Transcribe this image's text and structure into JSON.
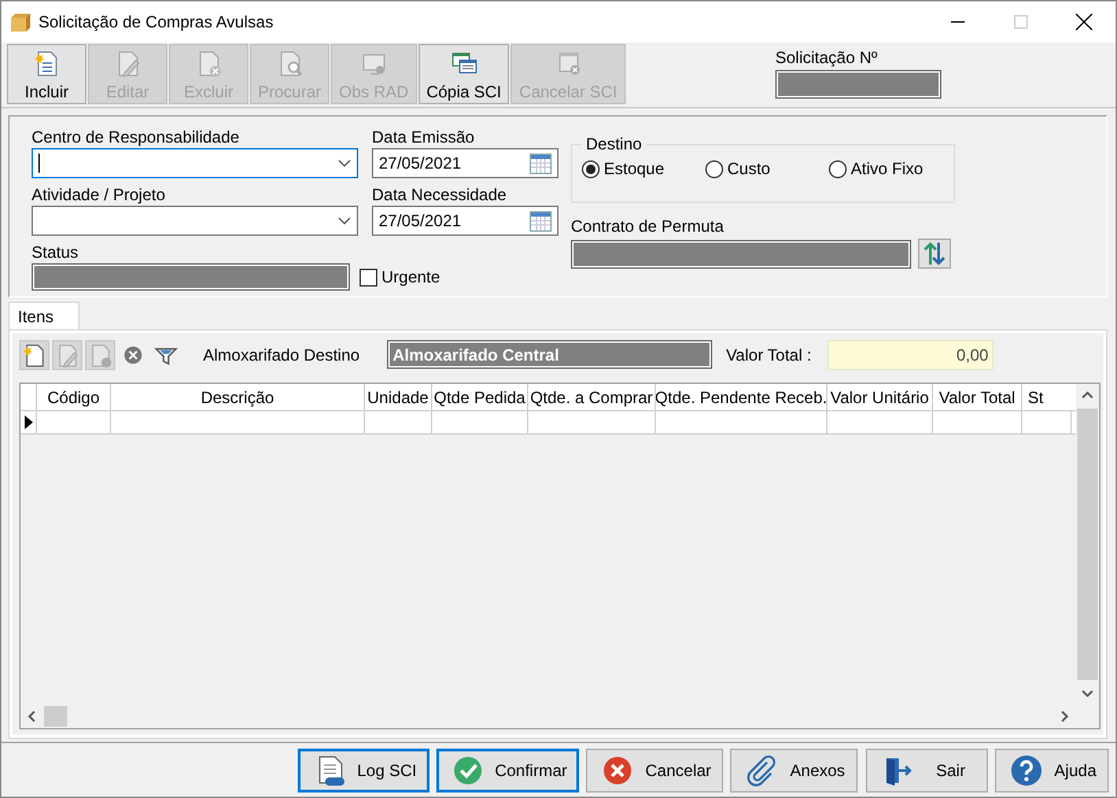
{
  "window": {
    "title": "Solicitação de Compras Avulsas"
  },
  "toolbar": [
    {
      "kind": "add",
      "label": "Incluir",
      "disabled": false
    },
    {
      "kind": "edit",
      "label": "Editar",
      "disabled": true
    },
    {
      "kind": "delete",
      "label": "Excluir",
      "disabled": true
    },
    {
      "kind": "search",
      "label": "Procurar",
      "disabled": true
    },
    {
      "kind": "note",
      "label": "Obs RAD",
      "disabled": true
    },
    {
      "kind": "copy",
      "label": "Cópia SCI",
      "disabled": false
    },
    {
      "kind": "cancel",
      "label": "Cancelar SCI",
      "disabled": true
    }
  ],
  "request_number": {
    "label": "Solicitação Nº"
  },
  "form": {
    "cost_center": {
      "label": "Centro de Responsabilidade",
      "focused": true
    },
    "issue_date": {
      "label": "Data Emissão",
      "value": "27/05/2021"
    },
    "activity": {
      "label": "Atividade / Projeto",
      "focused": false
    },
    "need_date": {
      "label": "Data Necessidade",
      "value": "27/05/2021"
    },
    "status": {
      "label": "Status"
    },
    "urgent": {
      "label": "Urgente",
      "checked": false
    },
    "destination": {
      "label": "Destino",
      "options": [
        {
          "label": "Estoque",
          "selected": true
        },
        {
          "label": "Custo",
          "selected": false
        },
        {
          "label": "Ativo Fixo",
          "selected": false
        }
      ]
    },
    "exchange_contract": {
      "label": "Contrato de Permuta"
    }
  },
  "tabs": [
    {
      "label": "Itens",
      "selected": true
    }
  ],
  "items": {
    "tools": [
      {
        "kind": "add",
        "disabled": false
      },
      {
        "kind": "edit",
        "disabled": true
      },
      {
        "kind": "delete",
        "disabled": true
      },
      {
        "kind": "remove",
        "disabled": false
      },
      {
        "kind": "filter",
        "disabled": false
      }
    ],
    "warehouse": {
      "label": "Almoxarifado Destino",
      "value": "Almoxarifado Central"
    },
    "total": {
      "label": "Valor Total :",
      "value": "0,00"
    }
  },
  "grid": {
    "columns": [
      "Código",
      "Descrição",
      "Unidade",
      "Qtde Pedida",
      "Qtde. a Comprar",
      "Qtde. Pendente Receb.",
      "Valor Unitário",
      "Valor Total",
      "St"
    ],
    "rows": [
      {
        "current": true
      }
    ]
  },
  "footer_buttons": [
    {
      "kind": "log",
      "label": "Log SCI",
      "focused": true
    },
    {
      "kind": "confirm",
      "label": "Confirmar",
      "focused": true
    },
    {
      "kind": "cancel",
      "label": "Cancelar",
      "focused": false
    },
    {
      "kind": "attach",
      "label": "Anexos",
      "focused": false
    },
    {
      "kind": "exit",
      "label": "Sair",
      "focused": false
    },
    {
      "kind": "help",
      "label": "Ajuda",
      "focused": false
    }
  ]
}
